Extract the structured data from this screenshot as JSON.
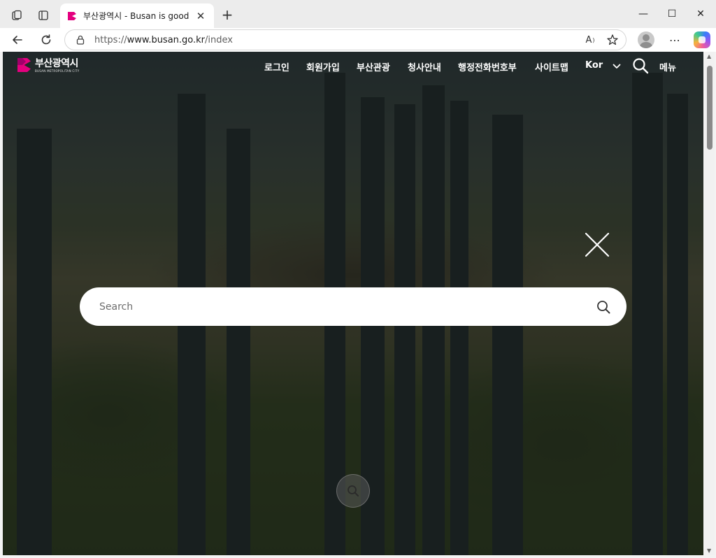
{
  "browser": {
    "tab": {
      "title": "부산광역시 - Busan is good",
      "close_glyph": "✕",
      "favicon": "busan-logo-icon"
    },
    "new_tab_glyph": "+",
    "window_controls": {
      "minimize": "—",
      "maximize": "☐",
      "close": "✕"
    },
    "address_bar": {
      "url_prefix": "https://",
      "url_host": "www.busan.go.kr",
      "url_path": "/index"
    },
    "read_aloud_label": "A",
    "more_glyph": "⋯"
  },
  "site": {
    "logo": {
      "name_ko": "부산광역시",
      "name_en": "BUSAN METROPOLITAN CITY"
    },
    "nav": [
      "로그인",
      "회원가입",
      "부산관광",
      "청사안내",
      "행정전화번호부",
      "사이트맵",
      "Kor"
    ],
    "menu_label": "메뉴",
    "accent_color": "#e4007f"
  },
  "search_overlay": {
    "placeholder": "Search"
  }
}
